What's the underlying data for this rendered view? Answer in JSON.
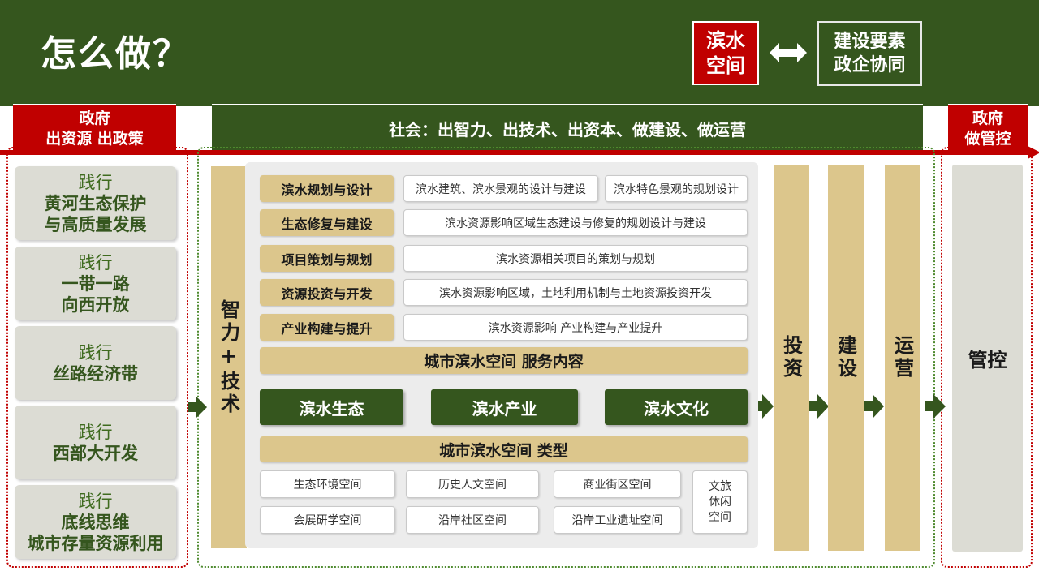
{
  "header": {
    "title": "怎么做？",
    "space_label": [
      "滨水",
      "空间"
    ],
    "coop_label": [
      "建设要素",
      "政企协同"
    ],
    "double_arrow": "⟺"
  },
  "government_left": [
    "政府",
    "出资源 出政策"
  ],
  "government_right": [
    "政府",
    "做管控"
  ],
  "society": "社会：出智力、出技术、出资本、做建设、做运营",
  "practices": [
    {
      "prefix": "践行",
      "lines": [
        "黄河生态保护",
        "与高质量发展"
      ]
    },
    {
      "prefix": "践行",
      "lines": [
        "一带一路",
        "向西开放"
      ]
    },
    {
      "prefix": "践行",
      "lines": [
        "丝路经济带"
      ]
    },
    {
      "prefix": "践行",
      "lines": [
        "西部大开发"
      ]
    },
    {
      "prefix": "践行",
      "lines": [
        "底线思维",
        "城市存量资源利用"
      ]
    }
  ],
  "wisdom_tech": "智力+技术",
  "services": [
    {
      "label": "滨水规划与设计",
      "items": [
        "滨水建筑、滨水景观的设计与建设",
        "滨水特色景观的规划设计"
      ]
    },
    {
      "label": "生态修复与建设",
      "items": [
        "滨水资源影响区域生态建设与修复的规划设计与建设"
      ]
    },
    {
      "label": "项目策划与规划",
      "items": [
        "滨水资源相关项目的策划与规划"
      ]
    },
    {
      "label": "资源投资与开发",
      "items": [
        "滨水资源影响区域，土地利用机制与土地资源投资开发"
      ]
    },
    {
      "label": "产业构建与提升",
      "items": [
        "滨水资源影响 产业构建与产业提升"
      ]
    }
  ],
  "service_title": "城市滨水空间 服务内容",
  "pillars": [
    "滨水生态",
    "滨水产业",
    "滨水文化"
  ],
  "type_title": "城市滨水空间 类型",
  "types": [
    [
      "生态环境空间",
      "历史人文空间",
      "商业街区空间"
    ],
    [
      "会展研学空间",
      "沿岸社区空间",
      "沿岸工业遗址空间"
    ]
  ],
  "type_extra": [
    "文旅",
    "休闲",
    "空间"
  ],
  "stages": [
    "投资",
    "建设",
    "运营"
  ],
  "control": "管控",
  "colors": {
    "green": "#35561e",
    "red": "#c00000",
    "gold": "#dcc68c",
    "gray": "#dcdcd4"
  }
}
